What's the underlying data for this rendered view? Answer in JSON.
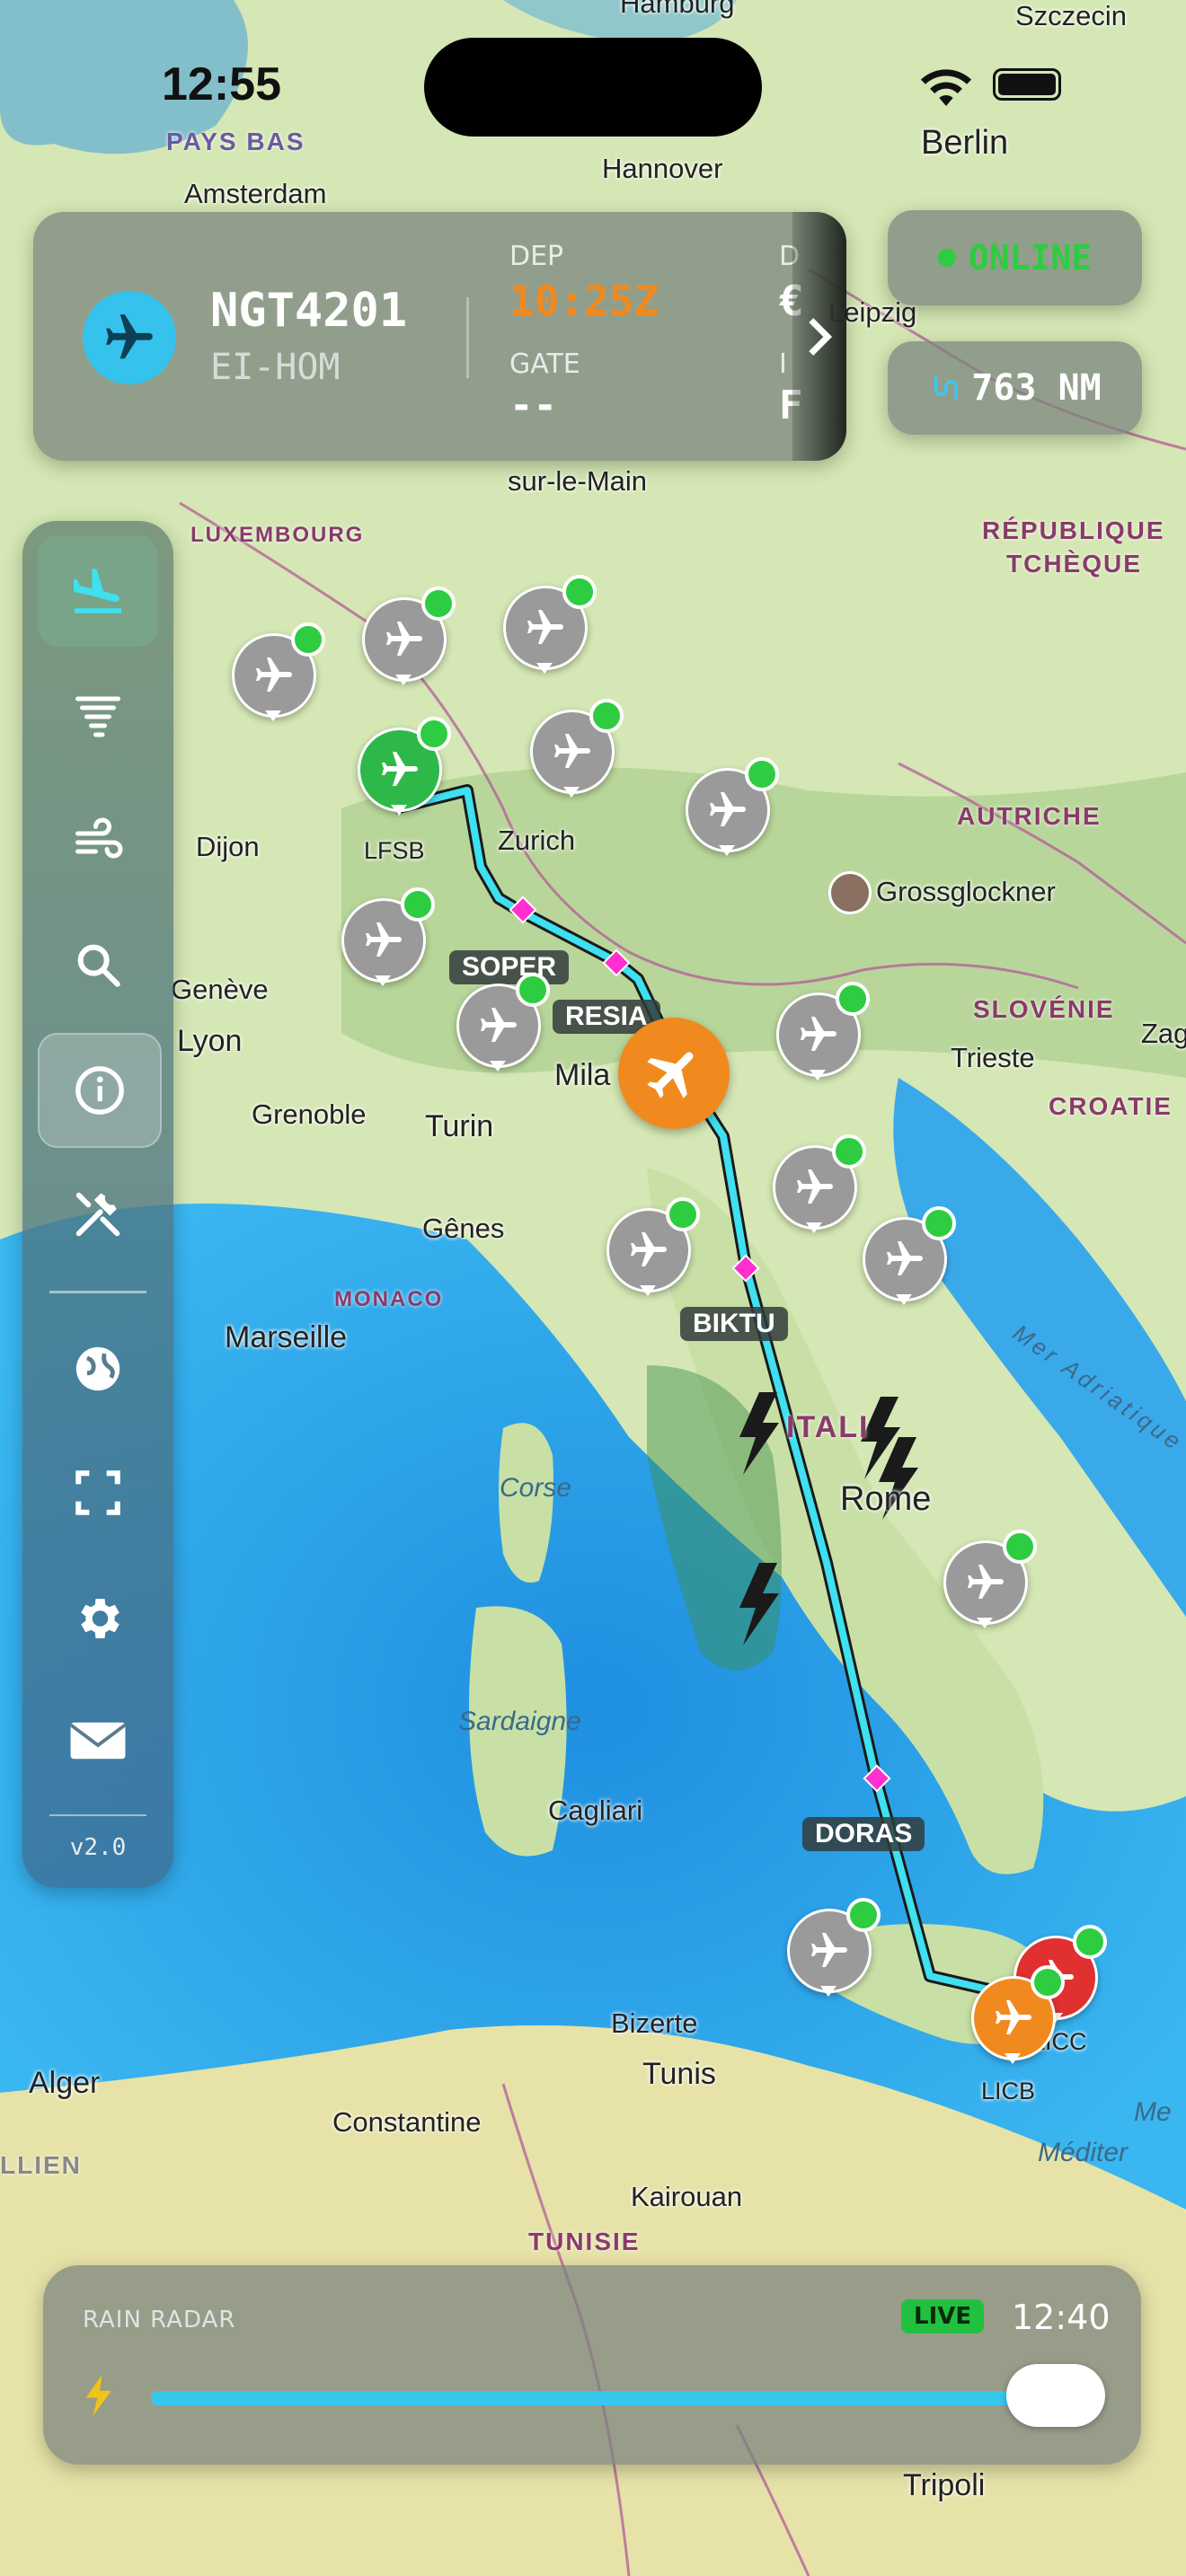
{
  "status_bar": {
    "time": "12:55"
  },
  "flight_card": {
    "callsign": "NGT4201",
    "registration": "EI-HOM",
    "dep_label": "DEP",
    "dep_time": "10:25Z",
    "gate_label": "GATE",
    "gate_value": "--",
    "clipped_label_1": "D",
    "clipped_value_1": "€",
    "clipped_label_2": "I",
    "clipped_value_2": "F"
  },
  "status": {
    "online": "ONLINE",
    "distance": "763 NM"
  },
  "sidebar": {
    "version": "v2.0",
    "items": [
      "arrivals-icon",
      "tornado-icon",
      "wind-icon",
      "search-icon",
      "info-icon",
      "tools-icon",
      "globe-icon",
      "fullscreen-icon",
      "gear-icon",
      "mail-icon"
    ]
  },
  "route": {
    "waypoints": [
      "SOPER",
      "RESIA",
      "BIKTU",
      "DORAS"
    ],
    "origin": "LFSB",
    "destination": "LICB",
    "destination_alt": "LICC"
  },
  "map_labels": {
    "cities": [
      "Hamburg",
      "Szczecin",
      "Berlin",
      "Amsterdam",
      "Hannover",
      "Leipzig",
      "sur-le-Main",
      "Zurich",
      "Dijon",
      "Genève",
      "Lyon",
      "Grenoble",
      "Turin",
      "Mila",
      "Gênes",
      "Marseille",
      "Rome",
      "Trieste",
      "Zag",
      "Cagliari",
      "Bizerte",
      "Tunis",
      "Alger",
      "Constantine",
      "Kairouan",
      "Tripoli",
      "Grossglockner"
    ],
    "countries": [
      "PAYS BAS",
      "LUXEMBOURG",
      "RÉPUBLIQUE",
      "TCHÈQUE",
      "AUTRICHE",
      "SLOVÉNIE",
      "CROATIE",
      "MONACO",
      "ITALI",
      "TUNISIE",
      "LLIEN"
    ],
    "seas": [
      "Corse",
      "Sardaigne",
      "Mer Adriatique",
      "Me",
      "Méditer"
    ]
  },
  "radar": {
    "title": "RAIN RADAR",
    "live": "LIVE",
    "time": "12:40",
    "progress": 0.95
  },
  "colors": {
    "accent": "#f08a1e",
    "route": "#3fe0f0",
    "online": "#2ecc40",
    "live_badge": "#22c040"
  }
}
